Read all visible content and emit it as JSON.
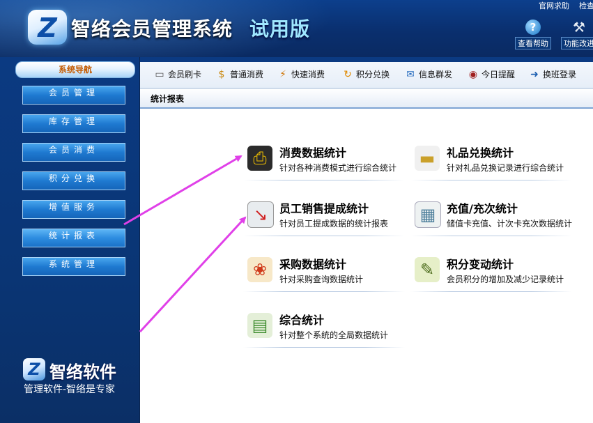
{
  "header": {
    "logo_glyph": "Z",
    "title": "智络会员管理系统",
    "title_suffix": "试用版",
    "links": [
      "官网求助",
      "检查"
    ],
    "buttons": [
      {
        "label": "查看帮助",
        "icon": "help-icon"
      },
      {
        "label": "功能改进",
        "icon": "tools-icon"
      }
    ]
  },
  "sidebar": {
    "title": "系统导航",
    "items": [
      {
        "label": "会员管理"
      },
      {
        "label": "库存管理"
      },
      {
        "label": "会员消费"
      },
      {
        "label": "积分兑换"
      },
      {
        "label": "增值服务"
      },
      {
        "label": "统计报表"
      },
      {
        "label": "系统管理"
      }
    ],
    "active_index": 5,
    "brand_name": "智络软件",
    "brand_slogan": "管理软件-智络是专家"
  },
  "toolbar": {
    "items": [
      {
        "label": "会员刷卡",
        "icon": "card-swipe-icon"
      },
      {
        "label": "普通消费",
        "icon": "money-bag-icon"
      },
      {
        "label": "快速消费",
        "icon": "fast-pay-icon"
      },
      {
        "label": "积分兑换",
        "icon": "points-exchange-icon"
      },
      {
        "label": "信息群发",
        "icon": "mail-icon"
      },
      {
        "label": "今日提醒",
        "icon": "clock-icon"
      },
      {
        "label": "换班登录",
        "icon": "shift-login-icon"
      }
    ]
  },
  "section": {
    "title": "统计报表"
  },
  "reports": [
    {
      "title": "消费数据统计",
      "desc": "针对各种消费模式进行综合统计",
      "icon": "pos-terminal-icon"
    },
    {
      "title": "礼品兑换统计",
      "desc": "针对礼品兑换记录进行综合统计",
      "icon": "cards-icon"
    },
    {
      "title": "员工销售提成统计",
      "desc": "针对员工提成数据的统计报表",
      "icon": "monitor-chart-icon"
    },
    {
      "title": "充值/充次统计",
      "desc": "储值卡充值、计次卡充次数据统计",
      "icon": "calculator-icon"
    },
    {
      "title": "采购数据统计",
      "desc": "针对采购查询数据统计",
      "icon": "fruit-basket-icon"
    },
    {
      "title": "积分变动统计",
      "desc": "会员积分的增加及减少记录统计",
      "icon": "notepad-icon"
    },
    {
      "title": "综合统计",
      "desc": "针对整个系统的全局数据统计",
      "icon": "money-chart-icon"
    }
  ],
  "colors": {
    "accent_blue": "#0b3a82",
    "nav_button": "#1f7ad1",
    "arrow": "#e040e8"
  }
}
